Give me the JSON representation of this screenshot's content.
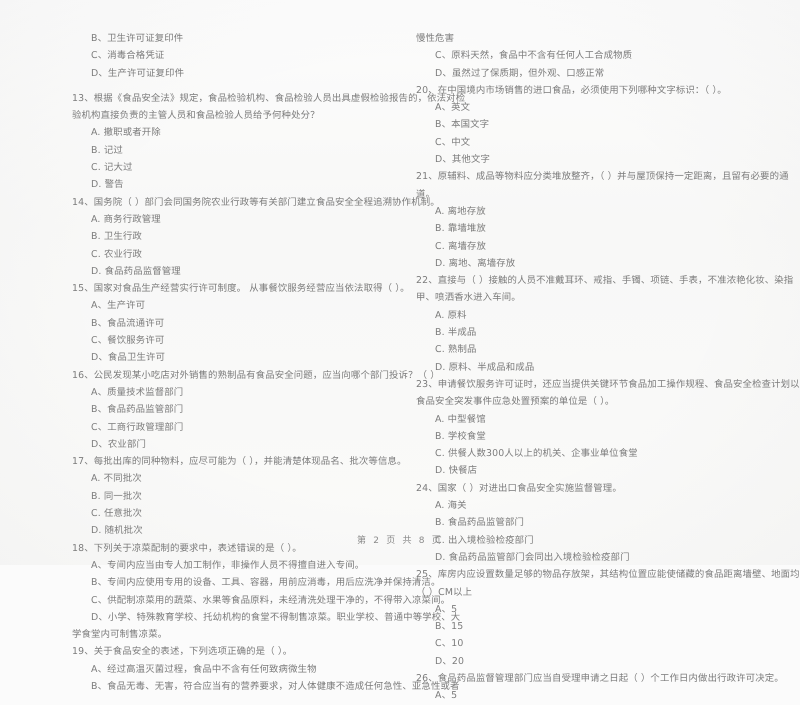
{
  "document": {
    "kind": "scanned-exam-paper",
    "language": "zh-CN",
    "footer": "第 2 页 共 8 页",
    "ink_color": "#7b7b7b",
    "paper_color": "#fbfbfb"
  },
  "left_column": {
    "lines": [
      {
        "kind": "option",
        "text": "B、卫生许可证复印件"
      },
      {
        "kind": "option",
        "text": "C、消毒合格凭证"
      },
      {
        "kind": "option",
        "text": "D、生产许可证复印件"
      },
      {
        "kind": "gap",
        "text": ""
      },
      {
        "kind": "question",
        "text": "13、根据《食品安全法》规定，食品检验机构、食品检验人员出具虚假检验报告的，依法对检"
      },
      {
        "kind": "cont",
        "text": "验机构直接负责的主管人员和食品检验人员给予何种处分？"
      },
      {
        "kind": "option",
        "text": "A. 撤职或者开除"
      },
      {
        "kind": "option",
        "text": "B. 记过"
      },
      {
        "kind": "option",
        "text": "C. 记大过"
      },
      {
        "kind": "option",
        "text": "D. 警告"
      },
      {
        "kind": "question",
        "text": "14、国务院（     ）部门会同国务院农业行政等有关部门建立食品安全全程追溯协作机制。"
      },
      {
        "kind": "option",
        "text": "A. 商务行政管理"
      },
      {
        "kind": "option",
        "text": "B. 卫生行政"
      },
      {
        "kind": "option",
        "text": "C. 农业行政"
      },
      {
        "kind": "option",
        "text": "D. 食品药品监督管理"
      },
      {
        "kind": "question",
        "text": "15、国家对食品生产经营实行许可制度。 从事餐饮服务经营应当依法取得（     ）。"
      },
      {
        "kind": "option",
        "text": "A、生产许可"
      },
      {
        "kind": "option",
        "text": "B、食品流通许可"
      },
      {
        "kind": "option",
        "text": "C、餐饮服务许可"
      },
      {
        "kind": "option",
        "text": "D、食品卫生许可"
      },
      {
        "kind": "question",
        "text": "16、公民发现某小吃店对外销售的熟制品有食品安全问题，应当向哪个部门投诉？（     ）"
      },
      {
        "kind": "option",
        "text": "A、质量技术监督部门"
      },
      {
        "kind": "option",
        "text": "B、食品药品监管部门"
      },
      {
        "kind": "option",
        "text": "C、工商行政管理部门"
      },
      {
        "kind": "option",
        "text": "D、农业部门"
      },
      {
        "kind": "question",
        "text": "17、每批出库的同种物料，应尽可能为（     ），并能清楚体现品名、批次等信息。"
      },
      {
        "kind": "option",
        "text": "A. 不同批次"
      },
      {
        "kind": "option",
        "text": "B. 同一批次"
      },
      {
        "kind": "option",
        "text": "C. 任意批次"
      },
      {
        "kind": "option",
        "text": "D. 随机批次"
      },
      {
        "kind": "question",
        "text": "18、下列关于凉菜配制的要求中，表述错误的是（     ）。"
      },
      {
        "kind": "option",
        "text": "A、专间内应当由专人加工制作，非操作人员不得擅自进入专间。"
      },
      {
        "kind": "option",
        "text": "B、专间内应使用专用的设备、工具、容器，用前应消毒，用后应洗净并保持清洁。"
      },
      {
        "kind": "option",
        "text": "C、供配制凉菜用的蔬菜、水果等食品原料，未经清洗处理干净的，不得带入凉菜间。"
      },
      {
        "kind": "option",
        "text": "D、小学、特殊教育学校、托幼机构的食堂不得制售凉菜。职业学校、普通中等学校、大"
      },
      {
        "kind": "cont",
        "text": "学食堂内可制售凉菜。"
      },
      {
        "kind": "question",
        "text": "19、关于食品安全的表述，下列选项正确的是（     ）。"
      },
      {
        "kind": "option",
        "text": "A、经过高温灭菌过程，食品中不含有任何致病微生物"
      },
      {
        "kind": "option",
        "text": "B、食品无毒、无害，符合应当有的营养要求，对人体健康不造成任何急性、亚急性或者"
      }
    ]
  },
  "right_column": {
    "lines": [
      {
        "kind": "cont",
        "text": "慢性危害"
      },
      {
        "kind": "option",
        "text": "C、原料天然，食品中不含有任何人工合成物质"
      },
      {
        "kind": "option",
        "text": "D、虽然过了保质期，但外观、口感正常"
      },
      {
        "kind": "question",
        "text": "20、在中国境内市场销售的进口食品，必须使用下列哪种文字标识：（     ）。"
      },
      {
        "kind": "option",
        "text": "A、英文"
      },
      {
        "kind": "option",
        "text": "B、本国文字"
      },
      {
        "kind": "option",
        "text": "C、中文"
      },
      {
        "kind": "option",
        "text": "D、其他文字"
      },
      {
        "kind": "question",
        "text": "21、原辅料、成品等物料应分类堆放整齐，（     ）并与屋顶保持一定距离，且留有必要的通"
      },
      {
        "kind": "cont",
        "text": "道。"
      },
      {
        "kind": "option",
        "text": "A. 离地存放"
      },
      {
        "kind": "option",
        "text": "B. 靠墙堆放"
      },
      {
        "kind": "option",
        "text": "C. 离墙存放"
      },
      {
        "kind": "option",
        "text": "D. 离地、离墙存放"
      },
      {
        "kind": "question",
        "text": "22、直接与（     ）接触的人员不准戴耳环、戒指、手镯、项链、手表，不准浓艳化妆、染指"
      },
      {
        "kind": "cont",
        "text": "甲、喷洒香水进入车间。"
      },
      {
        "kind": "option",
        "text": "A. 原料"
      },
      {
        "kind": "option",
        "text": "B. 半成品"
      },
      {
        "kind": "option",
        "text": "C. 熟制品"
      },
      {
        "kind": "option",
        "text": "D. 原料、半成品和成品"
      },
      {
        "kind": "question",
        "text": "23、申请餐饮服务许可证时，还应当提供关键环节食品加工操作规程、食品安全检查计划以及"
      },
      {
        "kind": "cont",
        "text": "食品安全突发事件应急处置预案的单位是（     ）。"
      },
      {
        "kind": "option",
        "text": "A. 中型餐馆"
      },
      {
        "kind": "option",
        "text": "B. 学校食堂"
      },
      {
        "kind": "option",
        "text": "C. 供餐人数300人以上的机关、企事业单位食堂"
      },
      {
        "kind": "option",
        "text": "D. 快餐店"
      },
      {
        "kind": "question",
        "text": "24、国家（     ）对进出口食品安全实施监督管理。"
      },
      {
        "kind": "option",
        "text": "A. 海关"
      },
      {
        "kind": "option",
        "text": "B. 食品药品监管部门"
      },
      {
        "kind": "option",
        "text": "C. 出入境检验检疫部门"
      },
      {
        "kind": "option",
        "text": "D. 食品药品监管部门会同出入境检验检疫部门"
      },
      {
        "kind": "question",
        "text": "25、库房内应设置数量足够的物品存放架，其结构位置应能使储藏的食品距离墙壁、地面均在"
      },
      {
        "kind": "cont",
        "text": "（     ）CM以上"
      },
      {
        "kind": "option",
        "text": "A、5"
      },
      {
        "kind": "option",
        "text": "B、15"
      },
      {
        "kind": "option",
        "text": "C、10"
      },
      {
        "kind": "option",
        "text": "D、20"
      },
      {
        "kind": "question",
        "text": "26、食品药品监督管理部门应当自受理申请之日起（     ）个工作日内做出行政许可决定。"
      },
      {
        "kind": "option",
        "text": "A、5"
      }
    ]
  }
}
